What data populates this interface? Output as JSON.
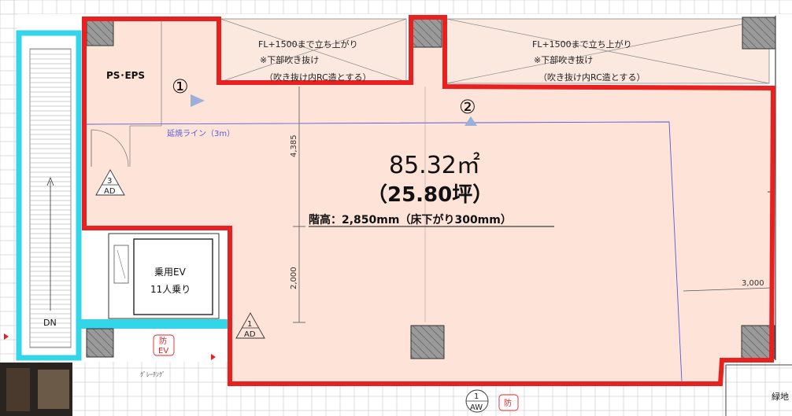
{
  "plan": {
    "area_m2": "85.32㎡",
    "area_tsubo": "（25.80坪）",
    "ceiling_height": "階高：2,850mm（床下がり300mm）",
    "ps_eps": "PS･EPS",
    "view_1": "①",
    "view_2": "②",
    "fire_line": "延焼ライン（3m）",
    "dim_4385": "4,385",
    "dim_2000": "2,000",
    "dim_3000": "3,000",
    "raised_note_1": "FL+1500まで立ち上がり",
    "void_note_1": "※下部吹き抜け",
    "void_rc_note_1": "（吹き抜け内RC造とする）",
    "raised_note_2": "FL+1500まで立ち上がり",
    "void_note_2": "※下部吹き抜け",
    "void_rc_note_2": "（吹き抜け内RC造とする）",
    "ev_label": "乗用EV",
    "ev_capacity": "11人乗り",
    "stair_dir": "DN",
    "tag_3_num": "3",
    "tag_3_code": "AD",
    "tag_1ad_num": "1",
    "tag_1ad_code": "AD",
    "tag_1aw_num": "1",
    "tag_1aw_code": "AW",
    "bou_ev_1": "防",
    "bou_ev_2": "EV",
    "bou_bottom": "防",
    "grating": "ｸﾞﾚｰﾁﾝｸﾞ",
    "ryokuchi": "緑地"
  },
  "colors": {
    "outline_red": "#e8201f",
    "area_fill": "#fde3d8",
    "cyan": "#33d6e8",
    "column_gray": "#9a9a9a",
    "fire_line_blue": "#5a5ad8"
  }
}
